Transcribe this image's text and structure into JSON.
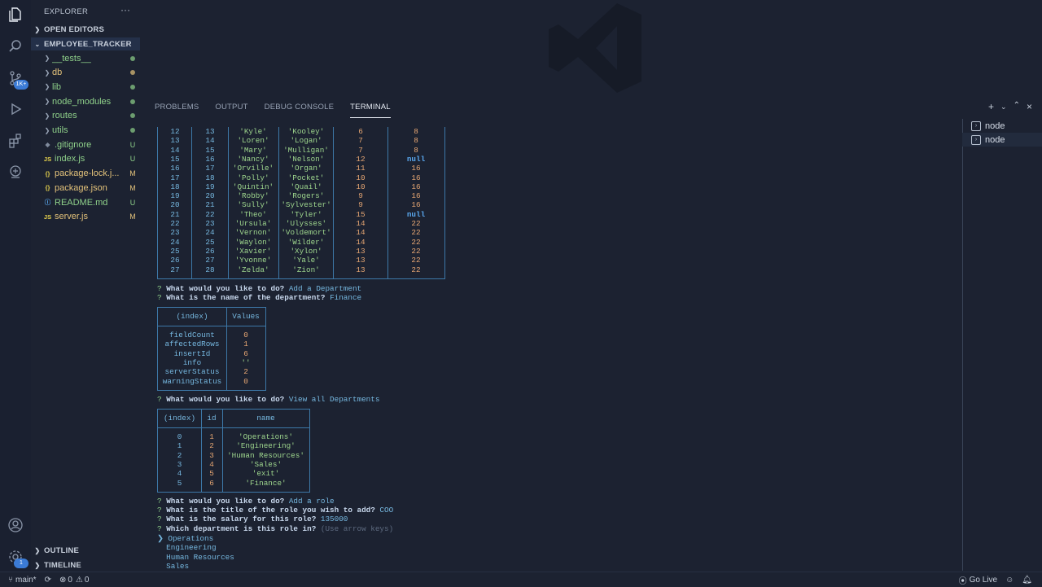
{
  "activity_bar": {
    "badge": "1K+",
    "account_badge": "1"
  },
  "sidebar": {
    "title": "EXPLORER",
    "more": "···",
    "open_editors": "OPEN EDITORS",
    "project": "EMPLOYEE_TRACKER",
    "items": [
      {
        "name": "__tests__",
        "type": "folder",
        "status": "dot",
        "color": "#8fd18a"
      },
      {
        "name": "db",
        "type": "folder",
        "status": "dot",
        "color": "#e3c27a"
      },
      {
        "name": "lib",
        "type": "folder",
        "status": "dot",
        "color": "#8fd18a"
      },
      {
        "name": "node_modules",
        "type": "folder",
        "status": "dot",
        "color": "#8fd18a"
      },
      {
        "name": "routes",
        "type": "folder",
        "status": "dot",
        "color": "#8fd18a"
      },
      {
        "name": "utils",
        "type": "folder",
        "status": "dot",
        "color": "#8fd18a"
      },
      {
        "name": ".gitignore",
        "type": "gitignore",
        "status": "U",
        "color": "#8fd18a"
      },
      {
        "name": "index.js",
        "type": "js",
        "status": "U",
        "color": "#8fd18a"
      },
      {
        "name": "package-lock.j...",
        "type": "json",
        "status": "M",
        "color": "#e3c27a"
      },
      {
        "name": "package.json",
        "type": "json",
        "status": "M",
        "color": "#e3c27a"
      },
      {
        "name": "README.md",
        "type": "md",
        "status": "U",
        "color": "#8fd18a"
      },
      {
        "name": "server.js",
        "type": "js",
        "status": "M",
        "color": "#e3c27a"
      }
    ],
    "outline": "OUTLINE",
    "timeline": "TIMELINE"
  },
  "panel": {
    "tabs": [
      "PROBLEMS",
      "OUTPUT",
      "DEBUG CONSOLE",
      "TERMINAL"
    ],
    "active_tab": "TERMINAL"
  },
  "terminal": {
    "employees_rows": [
      [
        "12",
        "13",
        "'Kyle'",
        "'Kooley'",
        "6",
        "8"
      ],
      [
        "13",
        "14",
        "'Loren'",
        "'Logan'",
        "7",
        "8"
      ],
      [
        "14",
        "15",
        "'Mary'",
        "'Mulligan'",
        "7",
        "8"
      ],
      [
        "15",
        "16",
        "'Nancy'",
        "'Nelson'",
        "12",
        "null"
      ],
      [
        "16",
        "17",
        "'Orville'",
        "'Organ'",
        "11",
        "16"
      ],
      [
        "17",
        "18",
        "'Polly'",
        "'Pocket'",
        "10",
        "16"
      ],
      [
        "18",
        "19",
        "'Quintin'",
        "'Quail'",
        "10",
        "16"
      ],
      [
        "19",
        "20",
        "'Robby'",
        "'Rogers'",
        "9",
        "16"
      ],
      [
        "20",
        "21",
        "'Sully'",
        "'Sylvester'",
        "9",
        "16"
      ],
      [
        "21",
        "22",
        "'Theo'",
        "'Tyler'",
        "15",
        "null"
      ],
      [
        "22",
        "23",
        "'Ursula'",
        "'Ulysses'",
        "14",
        "22"
      ],
      [
        "23",
        "24",
        "'Vernon'",
        "'Voldemort'",
        "14",
        "22"
      ],
      [
        "24",
        "25",
        "'Waylon'",
        "'Wilder'",
        "14",
        "22"
      ],
      [
        "25",
        "26",
        "'Xavier'",
        "'Xylon'",
        "13",
        "22"
      ],
      [
        "26",
        "27",
        "'Yvonne'",
        "'Yale'",
        "13",
        "22"
      ],
      [
        "27",
        "28",
        "'Zelda'",
        "'Zion'",
        "13",
        "22"
      ]
    ],
    "q1": {
      "mark": "?",
      "question": "What would you like to do?",
      "answer": "Add a Department"
    },
    "q2": {
      "mark": "?",
      "question": "What is the name of the department?",
      "answer": "Finance"
    },
    "result_table": {
      "headers": [
        "(index)",
        "Values"
      ],
      "rows": [
        [
          "fieldCount",
          "0"
        ],
        [
          "affectedRows",
          "1"
        ],
        [
          "insertId",
          "6"
        ],
        [
          "info",
          "''"
        ],
        [
          "serverStatus",
          "2"
        ],
        [
          "warningStatus",
          "0"
        ]
      ]
    },
    "q3": {
      "mark": "?",
      "question": "What would you like to do?",
      "answer": "View all Departments"
    },
    "departments_table": {
      "headers": [
        "(index)",
        "id",
        "name"
      ],
      "rows": [
        [
          "0",
          "1",
          "'Operations'"
        ],
        [
          "1",
          "2",
          "'Engineering'"
        ],
        [
          "2",
          "3",
          "'Human Resources'"
        ],
        [
          "3",
          "4",
          "'Sales'"
        ],
        [
          "4",
          "5",
          "'exit'"
        ],
        [
          "5",
          "6",
          "'Finance'"
        ]
      ]
    },
    "q4": {
      "mark": "?",
      "question": "What would you like to do?",
      "answer": "Add a role"
    },
    "q5": {
      "mark": "?",
      "question": "What is the title of the role you wish to add?",
      "answer": "COO"
    },
    "q6": {
      "mark": "?",
      "question": "What is the salary for this role?",
      "answer": "135000"
    },
    "q7": {
      "mark": "?",
      "question": "Which department is this role in?",
      "answer": "(Use arrow keys)"
    },
    "choices": [
      {
        "label": "❯ Operations",
        "selected": true
      },
      {
        "label": "  Engineering",
        "selected": false
      },
      {
        "label": "  Human Resources",
        "selected": false
      },
      {
        "label": "  Sales",
        "selected": false
      }
    ]
  },
  "terminal_list": [
    "node",
    "node"
  ],
  "statusbar": {
    "branch": "main*",
    "errors": "0",
    "warnings": "0",
    "go_live": "Go Live"
  }
}
